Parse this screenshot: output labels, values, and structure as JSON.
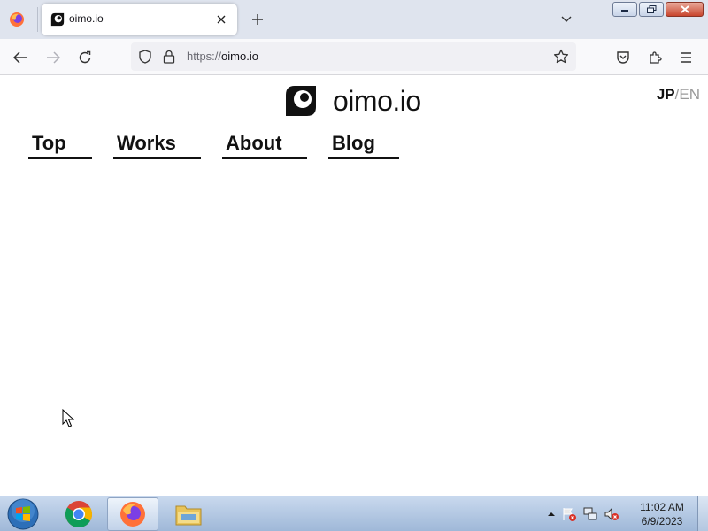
{
  "browser": {
    "tab": {
      "title": "oimo.io"
    },
    "url": {
      "scheme": "https://",
      "host": "oimo.io"
    }
  },
  "page": {
    "site_title": "oimo.io",
    "lang": {
      "jp": "JP",
      "separator": "/",
      "en": "EN"
    },
    "nav": [
      {
        "label": "Top"
      },
      {
        "label": "Works"
      },
      {
        "label": "About"
      },
      {
        "label": "Blog"
      }
    ]
  },
  "taskbar": {
    "apps": [
      "chrome-icon",
      "firefox-icon",
      "file-explorer-icon"
    ],
    "clock": {
      "time": "11:02 AM",
      "date": "6/9/2023"
    }
  },
  "colors": {
    "tabstrip_bg": "#dfe4ee",
    "navbar_bg": "#f9f9fb",
    "text": "#111111",
    "lang_inactive": "#9a9a9a",
    "taskbar_top": "#c9d9ee",
    "taskbar_bottom": "#9fb8d8"
  }
}
